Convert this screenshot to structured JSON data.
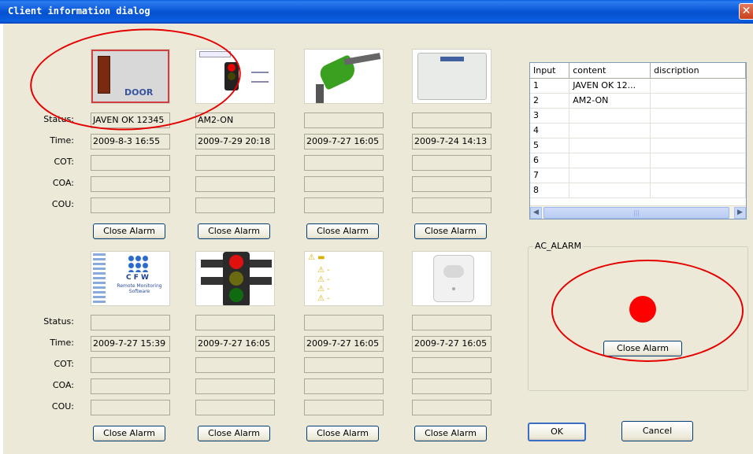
{
  "window": {
    "title": "Client information dialog",
    "close_glyph": "✕"
  },
  "labels": {
    "status": "Status:",
    "time": "Time:",
    "cot": "COT:",
    "coa": "COA:",
    "cou": "COU:"
  },
  "close_alarm_label": "Close Alarm",
  "sensors_row1": [
    {
      "icon": "door-icon",
      "thumb_text": "DOOR",
      "status": "JAVEN OK 12345",
      "time": "2009-8-3  16:55",
      "cot": "",
      "coa": "",
      "cou": ""
    },
    {
      "icon": "traffic-light-icon",
      "thumb_text": "",
      "status": "AM2-ON",
      "time": "2009-7-29  20:18",
      "cot": "",
      "coa": "",
      "cou": ""
    },
    {
      "icon": "fuel-nozzle-icon",
      "thumb_text": "",
      "status": "",
      "time": "2009-7-27  16:05",
      "cot": "",
      "coa": "",
      "cou": ""
    },
    {
      "icon": "control-box-icon",
      "thumb_text": "",
      "status": "",
      "time": "2009-7-24  14:13",
      "cot": "",
      "coa": "",
      "cou": ""
    }
  ],
  "sensors_row2": [
    {
      "icon": "cfw-logo-icon",
      "thumb_text": "C F W",
      "thumb_sub": "Remote Monitoring Software",
      "status": "",
      "time": "2009-7-27  15:39",
      "cot": "",
      "coa": "",
      "cou": ""
    },
    {
      "icon": "traffic-light-icon",
      "thumb_text": "",
      "status": "",
      "time": "2009-7-27  16:05",
      "cot": "",
      "coa": "",
      "cou": ""
    },
    {
      "icon": "warning-list-icon",
      "thumb_text": "",
      "status": "",
      "time": "2009-7-27  16:05",
      "cot": "",
      "coa": "",
      "cou": ""
    },
    {
      "icon": "motion-sensor-icon",
      "thumb_text": "",
      "status": "",
      "time": "2009-7-27  16:05",
      "cot": "",
      "coa": "",
      "cou": ""
    }
  ],
  "input_table": {
    "headers": [
      "Input",
      "content",
      "discription"
    ],
    "rows": [
      [
        "1",
        "JAVEN OK 12...",
        ""
      ],
      [
        "2",
        "AM2-ON",
        ""
      ],
      [
        "3",
        "",
        ""
      ],
      [
        "4",
        "",
        ""
      ],
      [
        "5",
        "",
        ""
      ],
      [
        "6",
        "",
        ""
      ],
      [
        "7",
        "",
        ""
      ],
      [
        "8",
        "",
        ""
      ]
    ]
  },
  "ac_alarm": {
    "caption": "AC_ALARM",
    "button": "Close Alarm",
    "led_color": "#ff0000"
  },
  "footer": {
    "ok": "OK",
    "cancel": "Cancel"
  },
  "colors": {
    "annotation": "#e40000",
    "titlebar": "#0a5fe0",
    "dialog_bg": "#ece9d8"
  }
}
